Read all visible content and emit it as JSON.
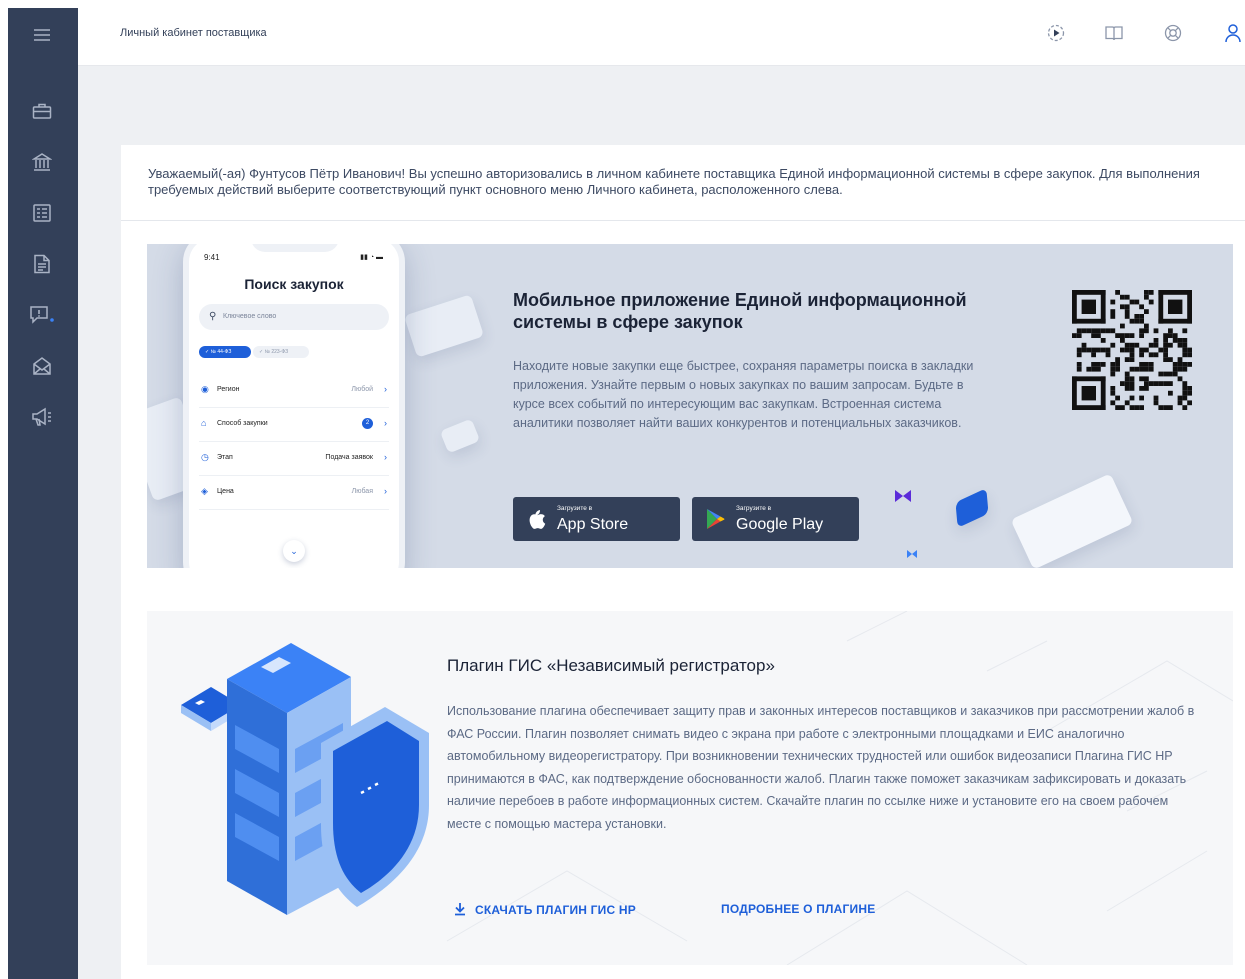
{
  "header": {
    "title": "Личный кабинет поставщика"
  },
  "welcome_text": "Уважаемый(-ая) Фунтусов Пётр Иванович! Вы успешно авторизовались в личном кабинете поставщика Единой информационной системы в сфере закупок. Для выполнения требуемых действий выберите соответствующий пункт основного меню Личного кабинета, расположенного слева.",
  "mobile_app": {
    "title": "Мобильное приложение Единой информационной системы в сфере закупок",
    "description": "Находите новые закупки еще быстрее, сохраняя параметры поиска в закладки приложения. Узнайте первым о новых закупках по вашим запросам. Будьте в курсе всех событий по интересующим вас закупкам. Встроенная система аналитики позволяет найти ваших конкурентов и потенциальных заказчиков.",
    "appstore": {
      "small": "Загрузите в",
      "label": "App Store"
    },
    "googleplay": {
      "small": "Загрузите в",
      "label": "Google Play"
    },
    "phone": {
      "time": "9:41",
      "title": "Поиск закупок",
      "search_placeholder": "Ключевое слово",
      "chip_active": "✓ № 44-ФЗ",
      "chip_inactive": "✓ № 223-ФЗ",
      "rows": [
        {
          "label": "Регион",
          "value": "Любой"
        },
        {
          "label": "Способ закупки",
          "value": "2"
        },
        {
          "label": "Этап",
          "value": "Подача заявок"
        },
        {
          "label": "Цена",
          "value": "Любая"
        }
      ]
    }
  },
  "plugin": {
    "title": "Плагин ГИС «Независимый регистратор»",
    "description": "Использование плагина обеспечивает защиту прав и законных интересов поставщиков и заказчиков при рассмотрении жалоб в ФАС России. Плагин позволяет снимать видео с экрана при работе с электронными площадками и ЕИС аналогично автомобильному видеорегистратору. При возникновении технических трудностей или ошибок видеозаписи Плагина ГИС НР принимаются в ФАС, как подтверждение обоснованности жалоб. Плагин также поможет заказчикам зафиксировать и доказать наличие перебоев в работе информационных систем. Скачайте плагин по ссылке ниже и установите его на своем рабочем месте с помощью мастера установки.",
    "download_label": "СКАЧАТЬ ПЛАГИН ГИС НР",
    "more_label": "ПОДРОБНЕЕ О ПЛАГИНЕ"
  },
  "icons": {
    "sidebar": [
      "menu-icon",
      "briefcase-icon",
      "bank-icon",
      "registry-icon",
      "document-icon",
      "complaint-icon",
      "mail-icon",
      "megaphone-icon"
    ],
    "top": [
      "play-icon",
      "book-icon",
      "help-icon",
      "user-icon"
    ]
  },
  "colors": {
    "sidebar": "#334059",
    "accent": "#1e5fd9",
    "banner": "#d4dbe7"
  }
}
